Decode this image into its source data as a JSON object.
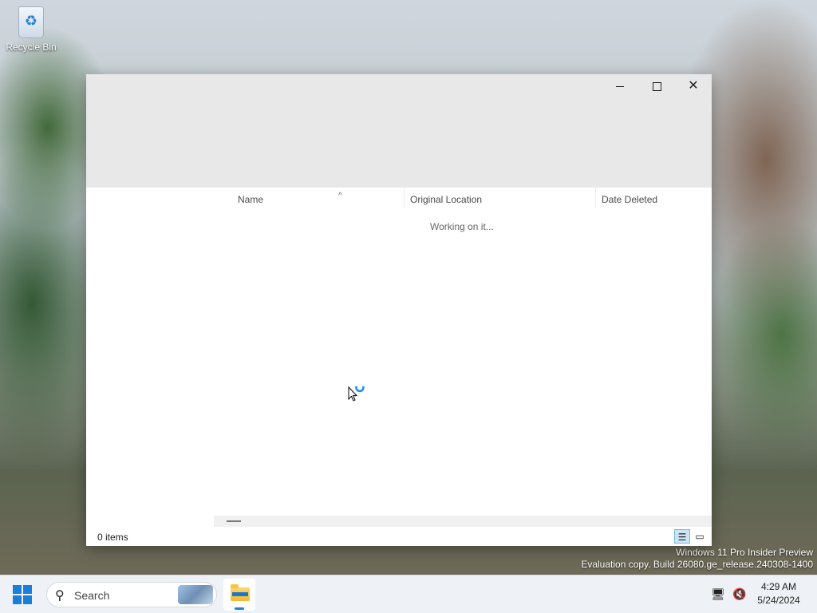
{
  "desktop": {
    "icons": [
      {
        "label": "Recycle Bin",
        "icon": "recycle-bin-icon"
      }
    ],
    "watermark": {
      "line1": "Windows 11 Pro Insider Preview",
      "line2": "Evaluation copy. Build 26080.ge_release.240308-1400"
    }
  },
  "window": {
    "caption_buttons": {
      "minimize": "minimize-icon",
      "maximize": "maximize-icon",
      "close": "close-icon"
    },
    "columns": [
      {
        "label": "Name",
        "sorted": "ascending"
      },
      {
        "label": "Original Location"
      },
      {
        "label": "Date Deleted"
      }
    ],
    "loading_text": "Working on it...",
    "status": {
      "item_count": "0 items"
    },
    "view_buttons": {
      "details": "details-view-icon",
      "tiles": "tiles-view-icon",
      "active": "details"
    }
  },
  "taskbar": {
    "search_placeholder": "Search",
    "pinned": [
      {
        "name": "File Explorer",
        "icon": "file-explorer-icon",
        "active": true
      }
    ],
    "tray": {
      "icons": [
        "network-icon",
        "volume-muted-icon"
      ]
    },
    "clock": {
      "time": "4:29 AM",
      "date": "5/24/2024"
    }
  },
  "colors": {
    "accent": "#1a7fd8",
    "titlebar": "#e8e8e8",
    "taskbar": "#eef1f5"
  }
}
